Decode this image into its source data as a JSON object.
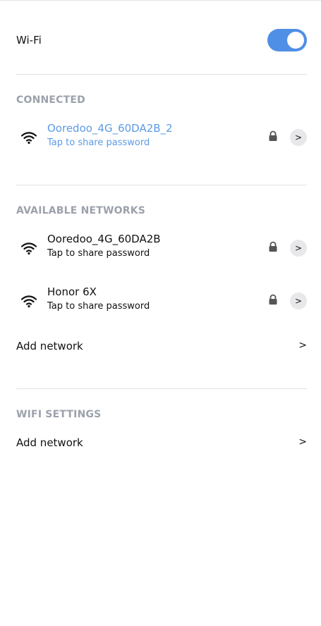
{
  "wifi": {
    "label": "Wi-Fi",
    "enabled": true,
    "accent_color": "#4f8fe6"
  },
  "connected": {
    "title": "CONNECTED",
    "network": {
      "name": "Ooredoo_4G_60DA2B_2",
      "subtitle": "Tap to share password",
      "icon": "wifi-icon",
      "locked": true,
      "color": "#5b9be6"
    }
  },
  "available": {
    "title": "AVAILABLE NETWORKS",
    "networks": [
      {
        "name": "Ooredoo_4G_60DA2B",
        "subtitle": "Tap to share password",
        "icon": "wifi-icon",
        "locked": true
      },
      {
        "name": "Honor 6X",
        "subtitle": "Tap to share password",
        "icon": "wifi-icon",
        "locked": true
      }
    ],
    "add_network": {
      "label": "Add network",
      "arrow": ">"
    }
  },
  "settings": {
    "title": "WIFI SETTINGS",
    "add_network": {
      "label": "Add network",
      "arrow": ">"
    }
  },
  "chevron_glyph": ">"
}
